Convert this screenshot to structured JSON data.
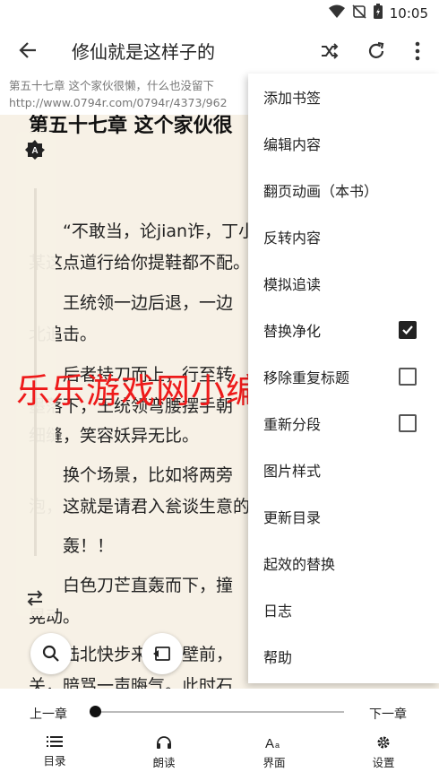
{
  "status_bar": {
    "time": "10:05",
    "icons": [
      "wifi-icon",
      "no-sim-icon",
      "battery-icon"
    ]
  },
  "app_bar": {
    "title": "修仙就是这样子的",
    "actions": [
      "shuffle-icon",
      "refresh-icon",
      "more-vert-icon"
    ]
  },
  "sub_info": {
    "chapter": "第五十七章 这个家伙很懒，什么也没留下",
    "url": "http://www.0794r.com/0794r/4373/962"
  },
  "reader": {
    "chapter_head": "第五十七章 这个家伙很",
    "paragraphs": [
      "“不敢当，论jian诈，丁小",
      "某这点道行给你提鞋都不配。",
      "王统领一边后退，一边",
      "北追击。",
      "后者持刀而上，行至转",
      "墨落下，王统领弯腰摆手朝",
      "细缝，笑容妖异无比。",
      "换个场景，比如将两旁",
      "泡，这就是请君入瓮谈生意的",
      "轰！！",
      "白色刀芒直轰而下，撞",
      "晃动。",
      "陆北快步来到石壁前，",
      "关，暗骂一声晦气。此时石"
    ],
    "background_color": "#f7f1e6"
  },
  "watermark": "乐乐游戏网小编亲测！",
  "menu": {
    "items": [
      {
        "label": "添加书签",
        "checkbox": null
      },
      {
        "label": "编辑内容",
        "checkbox": null
      },
      {
        "label": "翻页动画（本书）",
        "checkbox": null
      },
      {
        "label": "反转内容",
        "checkbox": null
      },
      {
        "label": "模拟追读",
        "checkbox": null
      },
      {
        "label": "替换净化",
        "checkbox": true
      },
      {
        "label": "移除重复标题",
        "checkbox": false
      },
      {
        "label": "重新分段",
        "checkbox": false
      },
      {
        "label": "图片样式",
        "checkbox": null
      },
      {
        "label": "更新目录",
        "checkbox": null
      },
      {
        "label": "起效的替换",
        "checkbox": null
      },
      {
        "label": "日志",
        "checkbox": null
      },
      {
        "label": "帮助",
        "checkbox": null
      }
    ]
  },
  "bottom": {
    "prev_chapter": "上一章",
    "next_chapter": "下一章",
    "progress": 0.0,
    "tabs": [
      {
        "label": "目录",
        "icon": "toc-icon"
      },
      {
        "label": "朗读",
        "icon": "headphones-icon"
      },
      {
        "label": "界面",
        "icon": "font-size-icon"
      },
      {
        "label": "设置",
        "icon": "gear-icon"
      }
    ]
  },
  "colors": {
    "accent": "#111111",
    "watermark": "#ee1a1a",
    "reader_bg": "#f7f1e6"
  }
}
